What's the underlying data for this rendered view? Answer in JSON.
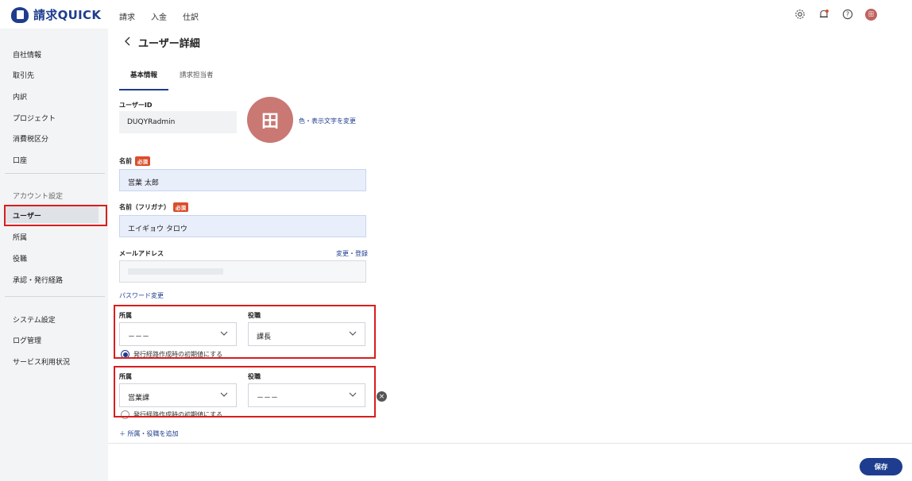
{
  "app": {
    "name": "請求QUICK"
  },
  "topnav": [
    "請求",
    "入金",
    "仕訳"
  ],
  "top_icons": [
    "gear-icon",
    "bell-icon",
    "help-icon"
  ],
  "user_avatar": "田",
  "sidebar": {
    "items_top": [
      "自社情報",
      "取引先",
      "内訳",
      "プロジェクト",
      "消費税区分",
      "口座"
    ],
    "section_account": "アカウント設定",
    "items_account": [
      "ユーザー",
      "所属",
      "役職",
      "承認・発行経路"
    ],
    "items_bottom": [
      "システム設定",
      "ログ管理",
      "サービス利用状況"
    ]
  },
  "page": {
    "title": "ユーザー詳細"
  },
  "tabs": [
    "基本情報",
    "請求担当者"
  ],
  "form": {
    "user_id_label": "ユーザーID",
    "user_id_value": "DUQYRadmin",
    "avatar_char": "田",
    "avatar_change_link": "色・表示文字を変更",
    "name_label": "名前",
    "required_badge": "必須",
    "name_value": "営業 太郎",
    "kana_label": "名前（フリガナ）",
    "kana_value": "エイギョウ タロウ",
    "email_label": "メールアドレス",
    "email_change_link": "変更・登録",
    "password_link": "パスワード変更",
    "affiliations": [
      {
        "dept_label": "所属",
        "dept_value": "－－－",
        "role_label": "役職",
        "role_value": "課長",
        "default_label": "発行経路作成時の初期値にする",
        "default_on": true
      },
      {
        "dept_label": "所属",
        "dept_value": "営業課",
        "role_label": "役職",
        "role_value": "－－－",
        "default_label": "発行経路作成時の初期値にする",
        "default_on": false
      }
    ],
    "add_link": "＋ 所属・役職を追加"
  },
  "footer": {
    "save_label": "保存"
  },
  "colors": {
    "brand": "#1e3d8f",
    "highlight": "#d81e1e",
    "avatar": "#c97874"
  }
}
